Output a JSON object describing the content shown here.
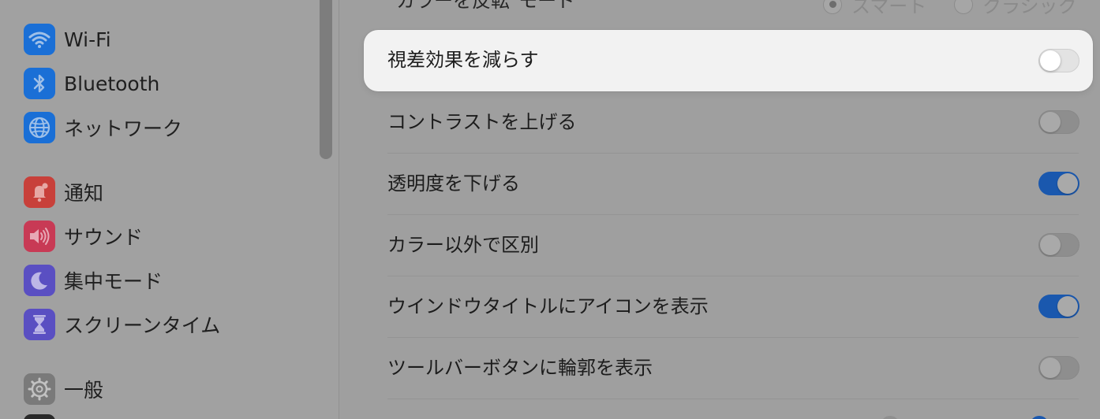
{
  "sidebar": {
    "items": [
      {
        "label": "Wi-Fi",
        "icon": "wifi-icon",
        "color": "#1a6fd6"
      },
      {
        "label": "Bluetooth",
        "icon": "bluetooth-icon",
        "color": "#1a6fd6"
      },
      {
        "label": "ネットワーク",
        "icon": "globe-icon",
        "color": "#1a6fd6"
      },
      {
        "label": "通知",
        "icon": "bell-icon",
        "color": "#c8403a"
      },
      {
        "label": "サウンド",
        "icon": "speaker-icon",
        "color": "#c83a55"
      },
      {
        "label": "集中モード",
        "icon": "moon-icon",
        "color": "#5a4fc2"
      },
      {
        "label": "スクリーンタイム",
        "icon": "hourglass-icon",
        "color": "#5a4fc2"
      },
      {
        "label": "一般",
        "icon": "gear-icon",
        "color": "#7a7a7a"
      }
    ]
  },
  "main": {
    "top_row": {
      "label": "\"カラーを反転\"モード",
      "options": [
        "スマート",
        "クラシック"
      ],
      "selected": "スマート"
    },
    "rows": [
      {
        "label": "視差効果を減らす",
        "enabled": false,
        "highlighted": true
      },
      {
        "label": "コントラストを上げる",
        "enabled": false
      },
      {
        "label": "透明度を下げる",
        "enabled": true
      },
      {
        "label": "カラー以外で区別",
        "enabled": false
      },
      {
        "label": "ウインドウタイトルにアイコンを表示",
        "enabled": true
      },
      {
        "label": "ツールバーボタンに輪郭を表示",
        "enabled": false
      }
    ]
  },
  "colors": {
    "accent": "#1a58ae",
    "dim_overlay": "#9f9f9f",
    "highlight_bg": "#f2f2f2"
  }
}
